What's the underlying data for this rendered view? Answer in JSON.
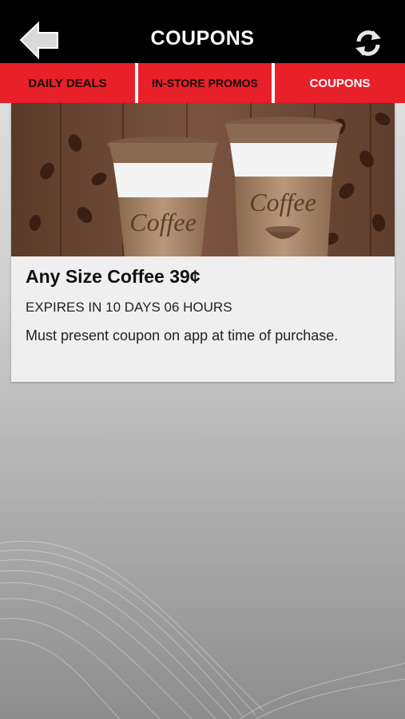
{
  "header": {
    "title": "COUPONS",
    "back_icon": "back-arrow-icon",
    "refresh_icon": "refresh-icon"
  },
  "tabs": [
    {
      "label": "DAILY DEALS",
      "active": false
    },
    {
      "label": "IN-STORE PROMOS",
      "active": false
    },
    {
      "label": "COUPONS",
      "active": true
    }
  ],
  "coupon": {
    "image_text_left": "Coffee",
    "image_text_right": "Coffee",
    "title": "Any Size Coffee 39¢",
    "expiry": "EXPIRES IN 10 DAYS 06 HOURS",
    "description": "Must present coupon on app at time of purchase."
  },
  "colors": {
    "topbar": "#000000",
    "tab_bar": "#e8202a",
    "card": "#efefef"
  }
}
